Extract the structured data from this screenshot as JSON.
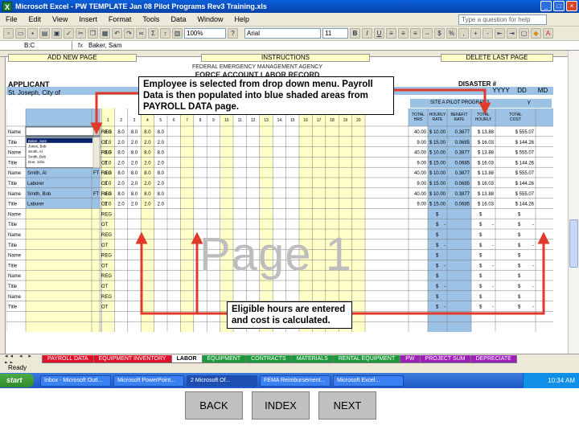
{
  "window": {
    "title": "Microsoft Excel - PW TEMPLATE Jan 08 Pilot Programs Rev3 Training.xls",
    "app_icon": "X"
  },
  "menu": [
    "File",
    "Edit",
    "View",
    "Insert",
    "Format",
    "Tools",
    "Data",
    "Window",
    "Help"
  ],
  "help_placeholder": "Type a question for help",
  "toolbar": {
    "zoom": "100%",
    "font": "Arial",
    "size": "11"
  },
  "formula_bar": {
    "cell_ref": "B:C",
    "fx": "fx",
    "value": "Baker, Sam"
  },
  "sheet": {
    "add_page_label": "ADD NEW PAGE",
    "instructions_label": "INSTRUCTIONS",
    "delete_page_label": "DELETE LAST PAGE",
    "form_title_1": "FEDERAL EMERGENCY MANAGEMENT AGENCY",
    "form_title_2": "FORCE ACCOUNT LABOR RECORD",
    "applicant_label": "APPLICANT",
    "applicant_name": "St. Joseph, City of",
    "disaster_label": "DISASTER #",
    "date_labels": [
      "YYYY",
      "DD",
      "MD"
    ],
    "pilot_label": "SITE A PILOT PROGRAM?",
    "pilot_value": "Y",
    "day_headers": [
      "1",
      "2",
      "3",
      "4",
      "5",
      "6",
      "7",
      "8",
      "9",
      "10",
      "11",
      "12",
      "13",
      "14",
      "15",
      "16",
      "17",
      "18",
      "19",
      "20"
    ],
    "total_headers": [
      "TOTAL HRS",
      "HOURLY RATE",
      "BENEFIT RATE",
      "TOTAL HOURLY",
      "TOTAL COST"
    ],
    "workers": [
      {
        "name": "Baker, Sam",
        "title": "Laborer",
        "ft": "FT",
        "reg_hours": [
          "8.0",
          "8.0",
          "8.0",
          "8.0",
          "8.0"
        ],
        "ot_hours": [
          "1.0",
          "2.0",
          "2.0",
          "2.0",
          "2.0"
        ],
        "reg_total": "40.00",
        "ot_total": "9.00",
        "reg_rate": "$ 10.00",
        "ot_rate": "$ 15.00",
        "reg_benefit": "0.3877",
        "ot_benefit": "0.0685",
        "reg_hourly": "$ 13.88",
        "ot_hourly": "$ 16.03",
        "reg_cost": "$ 555.07",
        "ot_cost": "$ 144.26"
      },
      {
        "name": "Jones, Bob",
        "title": "Laborer",
        "ft": "FT",
        "reg_hours": [
          "8.0",
          "8.0",
          "8.0",
          "8.0",
          "8.0"
        ],
        "ot_hours": [
          "1.0",
          "2.0",
          "2.0",
          "2.0",
          "2.0"
        ],
        "reg_total": "40.00",
        "ot_total": "9.00",
        "reg_rate": "$ 10.00",
        "ot_rate": "$ 15.00",
        "reg_benefit": "0.3877",
        "ot_benefit": "0.0685",
        "reg_hourly": "$ 13.88",
        "ot_hourly": "$ 16.03",
        "reg_cost": "$ 555.07",
        "ot_cost": "$ 144.26"
      },
      {
        "name": "Smith, Al",
        "title": "Laborer",
        "ft": "FT",
        "reg_hours": [
          "8.0",
          "8.0",
          "8.0",
          "8.0",
          "8.0"
        ],
        "ot_hours": [
          "1.0",
          "2.0",
          "2.0",
          "2.0",
          "2.0"
        ],
        "reg_total": "40.00",
        "ot_total": "9.00",
        "reg_rate": "$ 10.00",
        "ot_rate": "$ 15.00",
        "reg_benefit": "0.3877",
        "ot_benefit": "0.0685",
        "reg_hourly": "$ 13.88",
        "ot_hourly": "$ 16.03",
        "reg_cost": "$ 555.07",
        "ot_cost": "$ 144.26"
      },
      {
        "name": "Smith, Bob",
        "title": "Laborer",
        "ft": "FT",
        "reg_hours": [
          "8.0",
          "8.0",
          "8.0",
          "8.0",
          "8.0"
        ],
        "ot_hours": [
          "1.0",
          "2.0",
          "2.0",
          "2.0",
          "2.0"
        ],
        "reg_total": "40.00",
        "ot_total": "9.00",
        "reg_rate": "$ 10.00",
        "ot_rate": "$ 15.00",
        "reg_benefit": "0.3877",
        "ot_benefit": "0.0685",
        "reg_hourly": "$ 13.88",
        "ot_hourly": "$ 16.03",
        "reg_cost": "$ 555.07",
        "ot_cost": "$ 144.26"
      }
    ],
    "dropdown_options": [
      "Baker, Sam",
      "Jones, Bob",
      "Smith, Al",
      "Smith, Bob",
      "Doe, John"
    ],
    "empty_rows": 5,
    "name_label": "Name",
    "title_label": "Title",
    "reg_label": "REG",
    "ot_label": "OT",
    "dollar": "$",
    "dash": "-"
  },
  "callouts": {
    "top": "Employee is selected from drop down menu. Payroll Data is then populated into blue shaded areas from PAYROLL DATA page.",
    "bottom": "Eligible hours are entered and cost is calculated."
  },
  "watermark": "Page 1",
  "tabs": [
    {
      "label": "PAYROLL DATA",
      "color": "#e0102a",
      "active": false
    },
    {
      "label": "EQUIPMENT INVENTORY",
      "color": "#e0102a",
      "active": false
    },
    {
      "label": "LABOR",
      "color": "#ffffff",
      "active": true
    },
    {
      "label": "EQUIPMENT",
      "color": "#1c9a3b",
      "active": false
    },
    {
      "label": "CONTRACTS",
      "color": "#1c9a3b",
      "active": false
    },
    {
      "label": "MATERIALS",
      "color": "#1c9a3b",
      "active": false
    },
    {
      "label": "RENTAL EQUIPMENT",
      "color": "#1c9a3b",
      "active": false
    },
    {
      "label": "PW",
      "color": "#9b1fb8",
      "active": false
    },
    {
      "label": "PROJECT SUM",
      "color": "#9b1fb8",
      "active": false
    },
    {
      "label": "DEPRECIATE",
      "color": "#9b1fb8",
      "active": false
    }
  ],
  "tab_nav": "◂◂ ◂ ▸ ▸▸",
  "status": "Ready",
  "taskbar": {
    "start": "start",
    "tasks": [
      "Inbox - Microsoft Outl...",
      "Microsoft PowerPoint...",
      "2 Microsoft Of...",
      "FEMA Reimbursement...",
      "Microsoft Excel..."
    ],
    "tray_time": "10:34 AM"
  },
  "nav": {
    "back": "BACK",
    "index": "INDEX",
    "next": "NEXT"
  },
  "colors": {
    "blue_shade": "#9cc2e5",
    "yellow_shade": "#ffffc8",
    "arrow_red": "#e23a2a"
  }
}
